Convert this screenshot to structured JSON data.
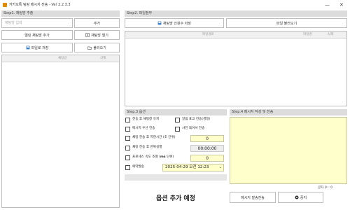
{
  "window": {
    "title": "카카오톡 팅팡 메시지 전송 - Ver 2.2.3.3",
    "minimize": "—",
    "close": "✕"
  },
  "step1": {
    "header": "Step1. 채팅방 추출",
    "room_input_placeholder": "채팅방 입력",
    "add_button": "추가",
    "open_rooms_add_button": "열린 채팅방 추가",
    "room_open_button": "채팅방 열기",
    "save_file_button": "파일로 저장",
    "load_button": "불러오기",
    "list_col_room": "채팅방",
    "list_col_delete": "삭제"
  },
  "step2": {
    "header": "Step2. 파일첨부",
    "room_capacity_save_button": "채팅방 인원수 저장",
    "file_load_button": "파일 불러오기",
    "col_path": "파일경로",
    "col_type": "파일명",
    "col_delete": "삭제"
  },
  "step3": {
    "header": "Step.3 옵션",
    "opt_keep_room": "전송 후 채팅창 유지",
    "opt_alert_report": "알림 표고 전송(경정)",
    "opt_message_first": "메시지 우선 전송",
    "opt_photo_first": "사진 묶어서 전송",
    "opt_delay_label": "채팅 전송 후 지연시간 (초 단위)",
    "opt_delay_value": "0",
    "opt_repeat_label": "채팅 전송 후 반복실행",
    "opt_repeat_value": "00:00:00",
    "opt_speed_label_a": "프로세스 속도 조절 (",
    "opt_speed_label_b": "ms",
    "opt_speed_label_c": " 단위)",
    "opt_speed_value": "0",
    "opt_reserve_label": "예약발송",
    "opt_reserve_value": "2025-04-29 오전 12:23"
  },
  "step4": {
    "header": "Step.4 메시지 작성 및 전송",
    "message_text": "",
    "char_count": "글자 수 : 0",
    "preview_button": "메시지 발송전송",
    "stop_button": "중지"
  },
  "bottom": {
    "banner": "옵션 추가 예정"
  },
  "colors": {
    "section_header": "#dcdcdc",
    "message_area": "#ffffcc",
    "app_icon": "#e08a00"
  }
}
